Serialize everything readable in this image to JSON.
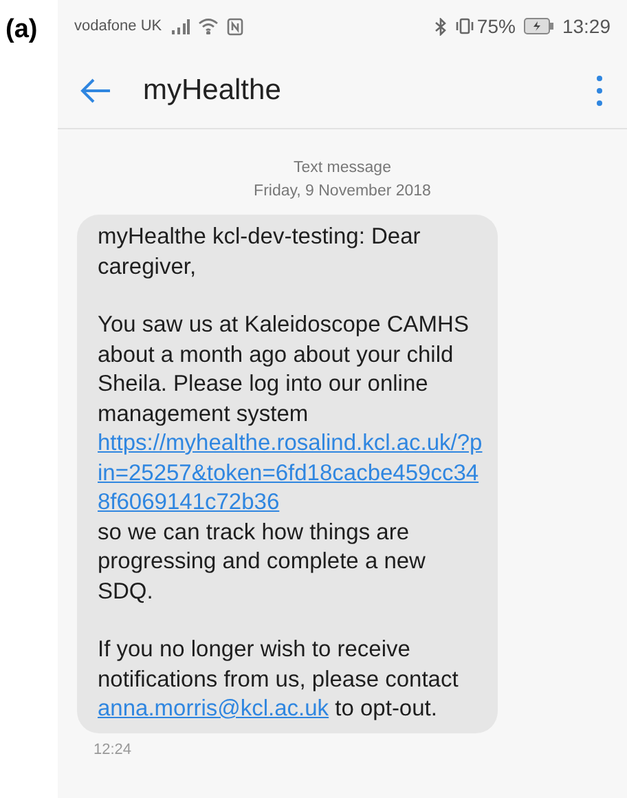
{
  "figure_label": "(a)",
  "status_bar": {
    "carrier": "vodafone UK",
    "battery": "75%",
    "time": "13:29"
  },
  "app_bar": {
    "title": "myHealthe"
  },
  "thread_header": {
    "label": "Text message",
    "date": "Friday, 9 November 2018"
  },
  "message": {
    "paragraphs": [
      [
        {
          "kind": "text",
          "text": "myHealthe kcl-dev-testing: Dear caregiver,"
        }
      ],
      [
        {
          "kind": "text",
          "text": "You saw us at Kaleidoscope CAMHS about a month ago about your child Sheila. Please log into our online management system"
        },
        {
          "kind": "link",
          "text": "https://myhealthe.rosalind.kcl.ac.uk/?pin=25257&token=6fd18cacbe459cc348f6069141c72b36"
        },
        {
          "kind": "text",
          "text": "so we can track how things are progressing and complete a new SDQ."
        }
      ],
      [
        {
          "kind": "text",
          "text": "If you no longer wish to receive notifications from us, please contact"
        },
        {
          "kind": "inline_link",
          "text": "anna.morris@kcl.ac.uk"
        },
        {
          "kind": "inline_text",
          "text": "to opt-out."
        }
      ]
    ],
    "time": "12:24"
  }
}
